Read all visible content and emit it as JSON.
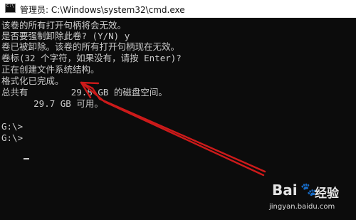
{
  "window": {
    "title": "管理员: C:\\Windows\\system32\\cmd.exe",
    "icon": "cmd-icon"
  },
  "console": {
    "lines": [
      "该卷的所有打开句柄将会无效。",
      "是否要强制卸除此卷? (Y/N) y",
      "卷已被卸除。该卷的所有打开句柄现在无效。",
      "卷标(32 个字符，如果没有，请按 Enter)?",
      "正在创建文件系统结构。",
      "格式化已完成。",
      "总共有        29.8 GB 的磁盘空间。",
      "      29.7 GB 可用。",
      "",
      "G:\\>",
      "G:\\>"
    ],
    "text_color": "#cccccc",
    "background": "#0c0c0c"
  },
  "annotation": {
    "arrow_color": "#cc1a1a"
  },
  "watermark": {
    "logo": "Bai",
    "paw": "🐾",
    "brand": "经验",
    "url": "jingyan.baidu.com"
  }
}
